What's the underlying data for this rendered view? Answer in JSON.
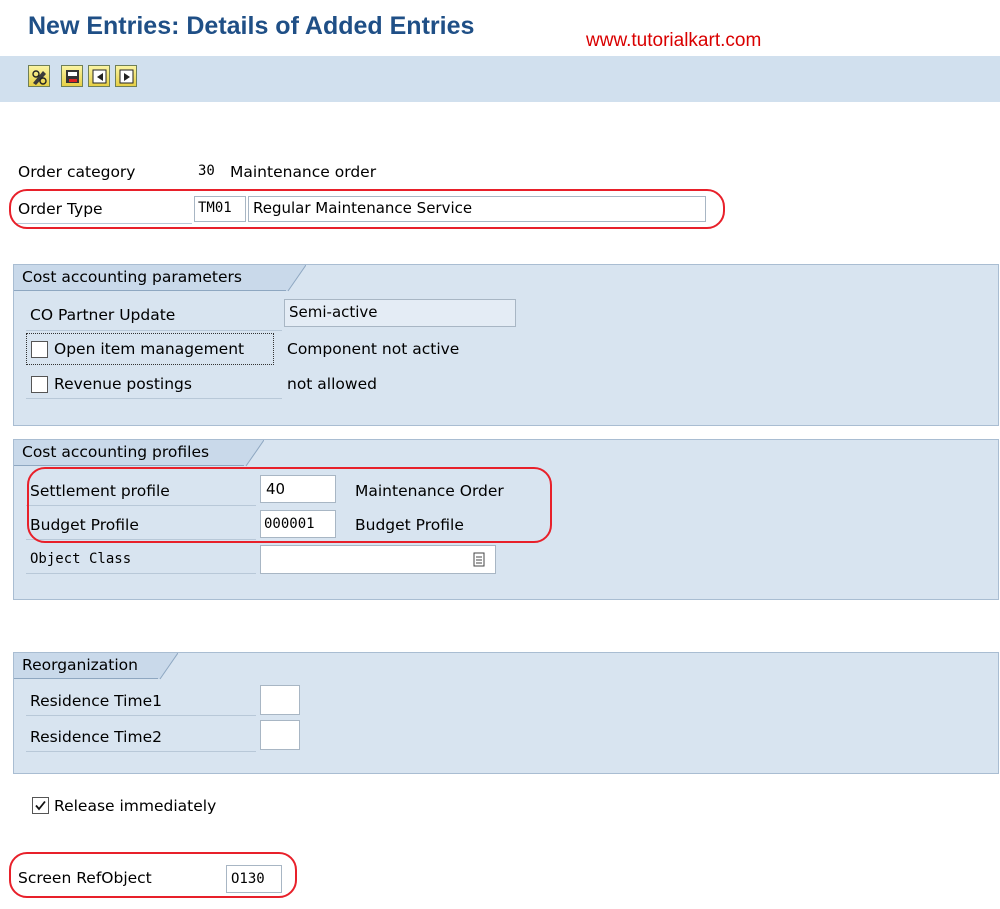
{
  "header": {
    "title": "New Entries: Details of Added Entries",
    "watermark": "www.tutorialkart.com"
  },
  "toolbar": {
    "buttons": [
      "pencil-glasses-icon",
      "save-delete-icon",
      "previous-entry-icon",
      "next-entry-icon"
    ]
  },
  "order": {
    "category_label": "Order category",
    "category_code": "30",
    "category_text": "Maintenance order",
    "type_label": "Order Type",
    "type_code": "TM01",
    "type_text": "Regular Maintenance Service"
  },
  "cost_params": {
    "title": "Cost accounting parameters",
    "co_partner_label": "CO Partner Update",
    "co_partner_value": "Semi-active",
    "open_item_label": "Open item management",
    "open_item_value": "Component not active",
    "open_item_checked": false,
    "revenue_label": "Revenue postings",
    "revenue_value": "not allowed",
    "revenue_checked": false
  },
  "cost_profiles": {
    "title": "Cost accounting profiles",
    "settlement_label": "Settlement profile",
    "settlement_value": "40",
    "settlement_text": "Maintenance Order",
    "budget_label": "Budget Profile",
    "budget_value": "000001",
    "budget_text": "Budget Profile",
    "object_class_label": "Object Class",
    "object_class_value": ""
  },
  "reorg": {
    "title": "Reorganization",
    "residence1_label": "Residence Time1",
    "residence1_value": "",
    "residence2_label": "Residence Time2",
    "residence2_value": ""
  },
  "release": {
    "label": "Release immediately",
    "checked": true
  },
  "screen_ref": {
    "label": "Screen RefObject",
    "value": "O130"
  },
  "colors": {
    "title": "#1f4f86",
    "watermark": "#d90000",
    "highlight": "#e8202a",
    "panel": "#d8e4f0"
  }
}
